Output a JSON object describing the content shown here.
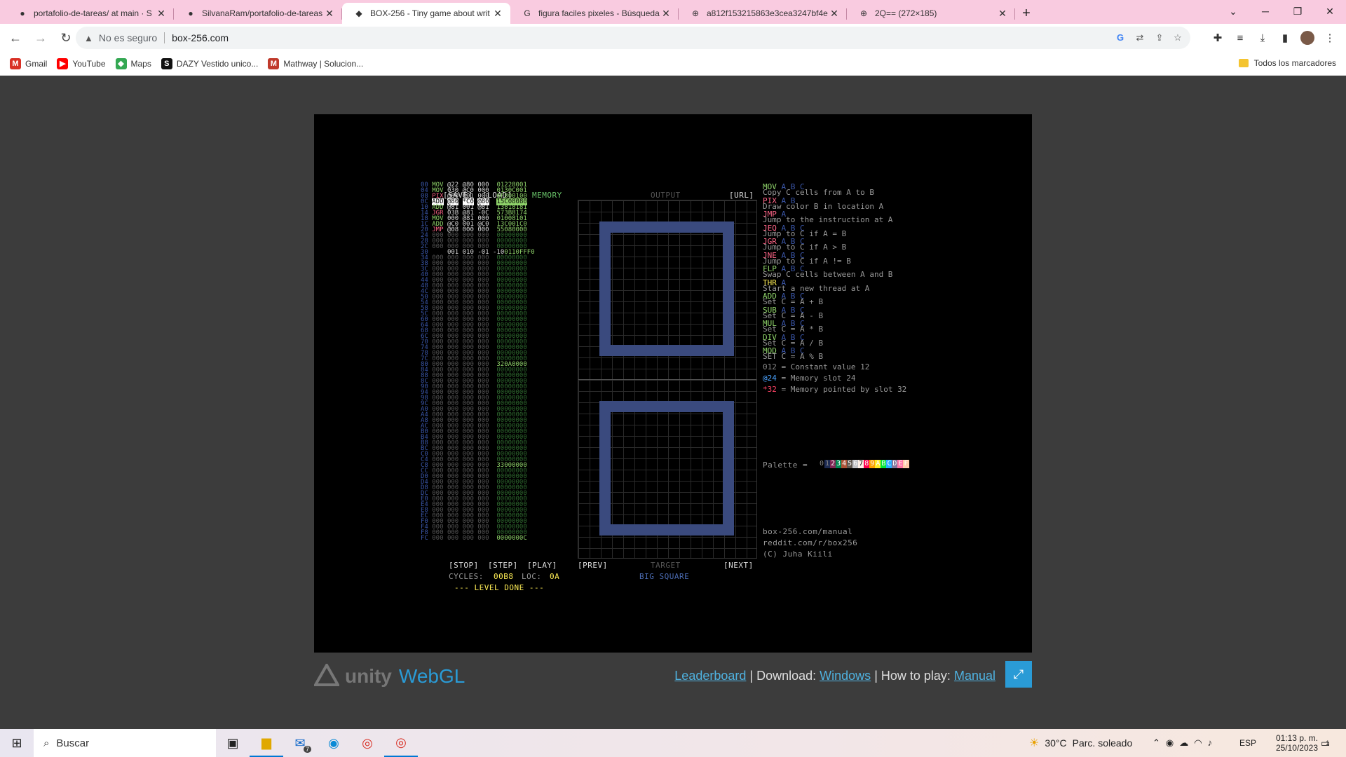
{
  "browser": {
    "tabs": [
      {
        "label": "portafolio-de-tareas/ at main · S",
        "icon": "github-icon",
        "active": false
      },
      {
        "label": "SilvanaRam/portafolio-de-tareas",
        "icon": "github-icon",
        "active": false
      },
      {
        "label": "BOX-256 - Tiny game about writ",
        "icon": "unity-icon",
        "active": true
      },
      {
        "label": "figura faciles pixeles - Búsqueda",
        "icon": "google-icon",
        "active": false
      },
      {
        "label": "a812f153215863e3cea3247bf4e",
        "icon": "globe-icon",
        "active": false
      },
      {
        "label": "2Q== (272×185)",
        "icon": "globe-icon",
        "active": false
      }
    ],
    "new_tab": "+",
    "window_controls": {
      "minimize": "─",
      "maximize": "❐",
      "close": "✕",
      "dropdown": "⌄"
    },
    "address": {
      "security": "No es seguro",
      "url": "box-256.com"
    },
    "bookmarks": [
      {
        "label": "Gmail",
        "icon": "gmail-icon",
        "color": "#d93025",
        "glyph": "M"
      },
      {
        "label": "YouTube",
        "icon": "youtube-icon",
        "color": "#ff0000",
        "glyph": "▶"
      },
      {
        "label": "Maps",
        "icon": "maps-icon",
        "color": "#34a853",
        "glyph": "◆"
      },
      {
        "label": "DAZY Vestido unico...",
        "icon": "dazy-icon",
        "color": "#111111",
        "glyph": "S"
      },
      {
        "label": "Mathway | Solucion...",
        "icon": "mathway-icon",
        "color": "#c0392b",
        "glyph": "M"
      }
    ],
    "all_bookmarks": "Todos los marcadores"
  },
  "game": {
    "header": {
      "save": "[SAVE]",
      "load": "[LOAD]",
      "memory": "MEMORY",
      "output": "OUTPUT",
      "url": "[URL]"
    },
    "program": [
      {
        "addr": "00",
        "op": "MOV",
        "a": "@22",
        "b": "@80",
        "c": "000",
        "mem": "01228001",
        "op_color": "#8fd36a"
      },
      {
        "addr": "04",
        "op": "MOV",
        "a": "030",
        "b": "@C0",
        "c": "000",
        "mem": "0130C001",
        "op_color": "#8fd36a"
      },
      {
        "addr": "08",
        "op": "PIX",
        "a": "@80",
        "b": "001",
        "c": "000",
        "mem": "6F800100",
        "op_color": "#ff6688"
      },
      {
        "addr": "0C",
        "op": "ADD",
        "a": "@80",
        "b": "*C0",
        "c": "@80",
        "mem": "15C08080",
        "op_color": "#ffffff",
        "hl": true
      },
      {
        "addr": "10",
        "op": "ADD",
        "a": "@81",
        "b": "001",
        "c": "@81",
        "mem": "13818181",
        "op_color": "#8fd36a"
      },
      {
        "addr": "14",
        "op": "JGR",
        "a": "03B",
        "b": "@81",
        "c": "-0C",
        "mem": "573B8174",
        "op_color": "#ff6688"
      },
      {
        "addr": "18",
        "op": "MOV",
        "a": "000",
        "b": "@81",
        "c": "000",
        "mem": "01008101",
        "op_color": "#8fd36a"
      },
      {
        "addr": "1C",
        "op": "ADD",
        "a": "@C0",
        "b": "001",
        "c": "@C0",
        "mem": "13C001C0",
        "op_color": "#8fd36a"
      },
      {
        "addr": "20",
        "op": "JMP",
        "a": "@08",
        "b": "000",
        "c": "000",
        "mem": "55080000",
        "op_color": "#ff6688"
      },
      {
        "addr": "30",
        "op": "",
        "a": "001",
        "b": "010",
        "c": "-01",
        "d": "-10",
        "mem": "0110FFF0",
        "op_color": "#ffffff"
      }
    ],
    "mem_tail": {
      "80": "320A0000",
      "C8": "33000000",
      "FC": "0000000C"
    },
    "controls": {
      "stop": "[STOP]",
      "step": "[STEP]",
      "play": "[PLAY]",
      "prev": "[PREV]",
      "target": "TARGET",
      "next": "[NEXT]"
    },
    "status": {
      "cycles_label": "CYCLES:",
      "cycles": "00B8",
      "loc_label": "LOC:",
      "loc": "0A",
      "level_done": "--- LEVEL DONE ---"
    },
    "level_name": "BIG SQUARE",
    "reference": [
      {
        "op": "MOV",
        "args": "A B C",
        "desc": "Copy C cells from A to B",
        "color": "#8fd36a"
      },
      {
        "op": "PIX",
        "args": "A B",
        "desc": "Draw color B in location A",
        "color": "#ff6688"
      },
      {
        "op": "JMP",
        "args": "A",
        "desc": "Jump to the instruction at A",
        "color": "#ff6688"
      },
      {
        "op": "JEQ",
        "args": "A B C",
        "desc": "Jump to C if A = B",
        "color": "#ff6688"
      },
      {
        "op": "JGR",
        "args": "A B C",
        "desc": "Jump to C if A > B",
        "color": "#ff6688"
      },
      {
        "op": "JNE",
        "args": "A B C",
        "desc": "Jump to C if A != B",
        "color": "#ff6688"
      },
      {
        "op": "FLP",
        "args": "A B C",
        "desc": "Swap C cells between A and B",
        "color": "#8fd36a"
      },
      {
        "op": "THR",
        "args": "A",
        "desc": "Start a new thread at A",
        "color": "#ffee55"
      },
      {
        "op": "ADD",
        "args": "A B C",
        "desc": "Set C = A + B",
        "color": "#8fd36a"
      },
      {
        "op": "SUB",
        "args": "A B C",
        "desc": "Set C = A - B",
        "color": "#8fd36a"
      },
      {
        "op": "MUL",
        "args": "A B C",
        "desc": "Set C = A * B",
        "color": "#8fd36a"
      },
      {
        "op": "DIV",
        "args": "A B C",
        "desc": "Set C = A / B",
        "color": "#8fd36a"
      },
      {
        "op": "MOD",
        "args": "A B C",
        "desc": "SET C = A % B",
        "color": "#8fd36a"
      }
    ],
    "legend": [
      {
        "sym": "012",
        "desc": "= Constant value 12",
        "color": "#888888"
      },
      {
        "sym": "@24",
        "desc": "= Memory slot 24",
        "color": "#4aa3ff"
      },
      {
        "sym": "*32",
        "desc": "= Memory pointed by slot 32",
        "color": "#ff4466"
      }
    ],
    "palette_label": "Palette =",
    "palette": [
      "0",
      "1",
      "2",
      "3",
      "4",
      "5",
      "6",
      "7",
      "8",
      "9",
      "A",
      "B",
      "C",
      "D",
      "E",
      "F"
    ],
    "palette_colors": [
      "#000000",
      "#1d2b53",
      "#7e2553",
      "#008751",
      "#ab5236",
      "#5f574f",
      "#c2c3c7",
      "#fff1e8",
      "#ff004d",
      "#ffa300",
      "#ffec27",
      "#00e436",
      "#29adff",
      "#83769c",
      "#ff77a8",
      "#ffccaa"
    ],
    "links": [
      "box-256.com/manual",
      "reddit.com/r/box256",
      "(C) Juha Kiili"
    ]
  },
  "footer": {
    "unity": "unity",
    "webgl": "WebGL",
    "leaderboard": "Leaderboard",
    "sep1": "| Download:",
    "windows": "Windows",
    "sep2": "| How to play:",
    "manual": "Manual"
  },
  "taskbar": {
    "search": "Buscar",
    "weather_temp": "30°C",
    "weather_desc": "Parc. soleado",
    "lang": "ESP",
    "time": "01:13 p. m.",
    "date": "25/10/2023",
    "mail_badge": "7",
    "notif_badge": "1"
  }
}
